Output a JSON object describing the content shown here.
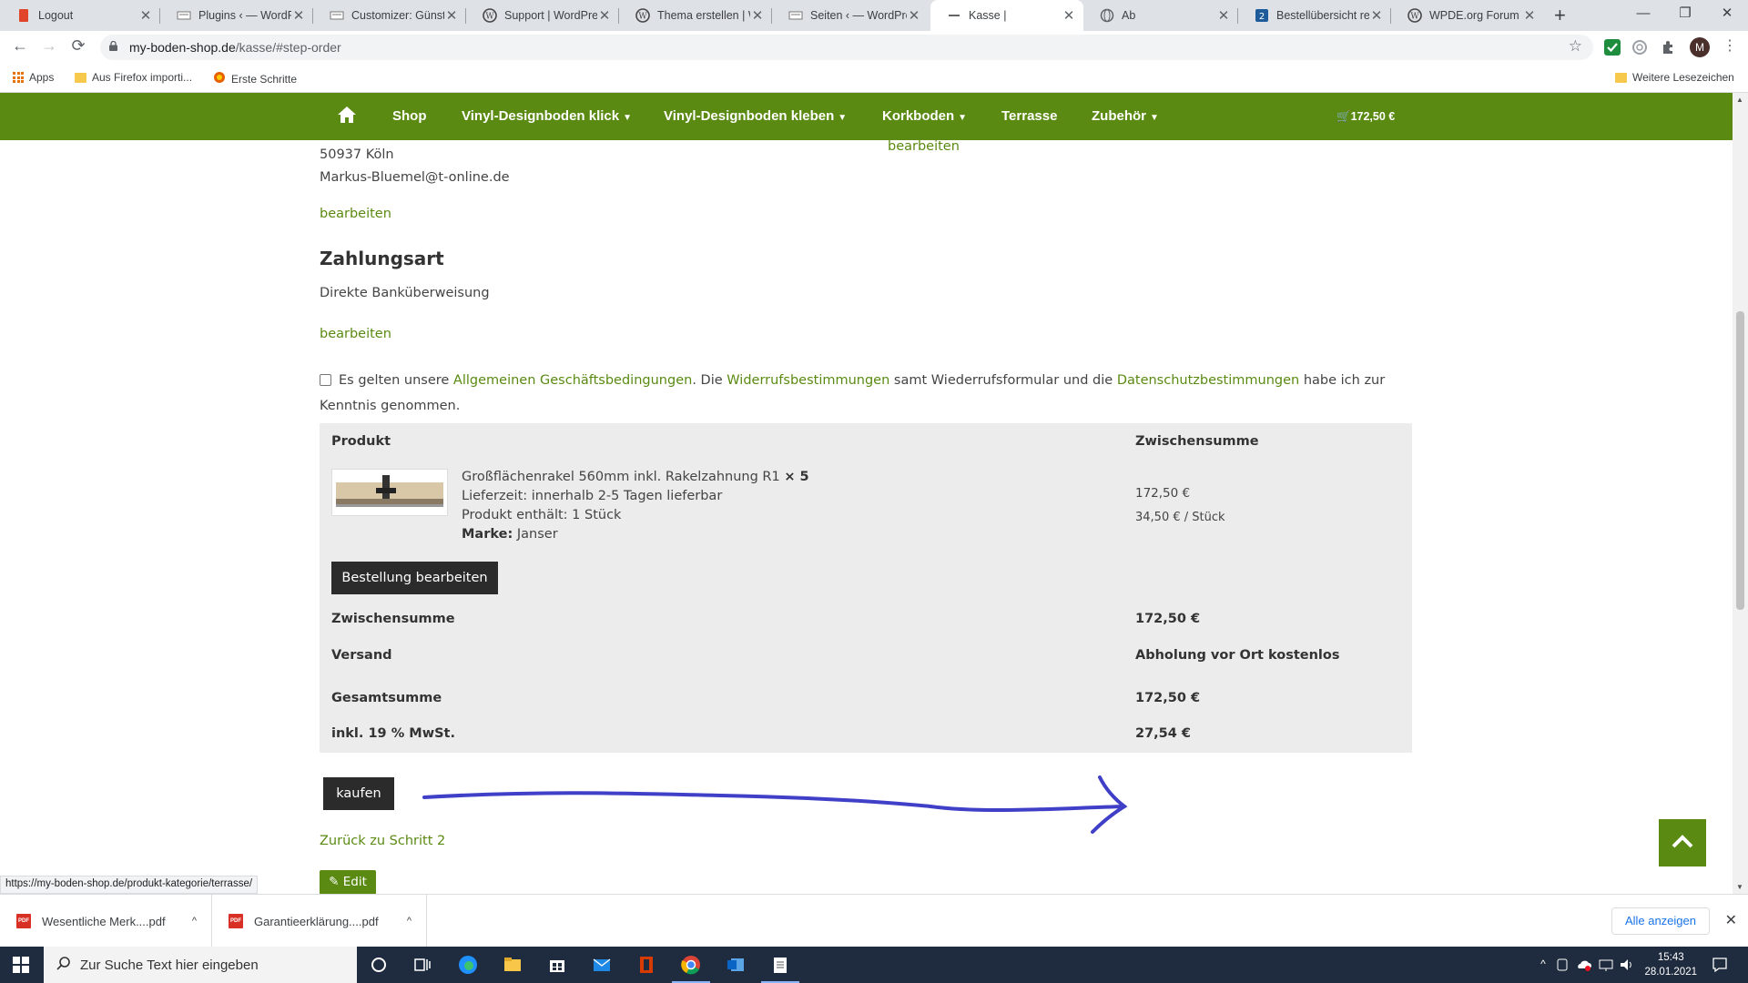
{
  "browser": {
    "tabs": [
      {
        "title": "Logout",
        "favicon": "red-document-icon"
      },
      {
        "title": "Plugins ‹ — WordPr",
        "favicon": "page-icon"
      },
      {
        "title": "Customizer: Günstig",
        "favicon": "page-icon"
      },
      {
        "title": "Support | WordPres",
        "favicon": "wordpress-icon"
      },
      {
        "title": "Thema erstellen | W",
        "favicon": "wordpress-icon"
      },
      {
        "title": "Seiten ‹ — WordPre",
        "favicon": "page-icon"
      },
      {
        "title": "Kasse |",
        "favicon": "dash-icon",
        "active": true
      },
      {
        "title": "Ab",
        "favicon": "globe-icon"
      },
      {
        "title": "Bestellübersicht rec",
        "favicon": "blue-square-icon"
      },
      {
        "title": "WPDE.org Forum",
        "favicon": "wordpress-icon"
      }
    ],
    "url_host": "my-boden-shop.de",
    "url_path": "/kasse/#step-order",
    "bookmarks": [
      "Apps",
      "Aus Firefox importi...",
      "Erste Schritte"
    ],
    "other_bookmarks": "Weitere Lesezeichen",
    "profile_initial": "M",
    "status_url": "https://my-boden-shop.de/produkt-kategorie/terrasse/"
  },
  "site_nav": {
    "items": [
      "Shop",
      "Vinyl-Designboden klick",
      "Vinyl-Designboden kleben",
      "Korkboden",
      "Terrasse",
      "Zubehör"
    ],
    "cart_total": "172,50 €"
  },
  "address": {
    "city": "50937 Köln",
    "email": "Markus-Bluemel@t-online.de",
    "edit": "bearbeiten",
    "edit_right": "bearbeiten"
  },
  "payment": {
    "heading": "Zahlungsart",
    "method": "Direkte Banküberweisung",
    "edit": "bearbeiten"
  },
  "terms": {
    "t1": "Es gelten unsere",
    "agb": "Allgemeinen Geschäftsbedingungen",
    "t2": ". Die",
    "widerruf": "Widerrufsbestimmungen",
    "t3": "samt Wiederrufsformular und die",
    "datenschutz": "Datenschutzbestimmungen",
    "t4": "habe ich zur Kenntnis genommen."
  },
  "order": {
    "col_product": "Produkt",
    "col_subtotal": "Zwischensumme",
    "product_name": "Großflächenrakel 560mm inkl. Rakelzahnung R1",
    "product_qty": "× 5",
    "delivery": "Lieferzeit: innerhalb 2-5 Tagen lieferbar",
    "contents": "Produkt enthält: 1 Stück",
    "brand_label": "Marke:",
    "brand": "Janser",
    "line_total": "172,50 €",
    "unit_price": "34,50 € / Stück",
    "edit_order": "Bestellung bearbeiten",
    "rows": [
      {
        "label": "Zwischensumme",
        "value": "172,50 €"
      },
      {
        "label": "Versand",
        "value": "Abholung vor Ort kostenlos"
      },
      {
        "label": "Gesamtsumme",
        "value": "172,50 €"
      },
      {
        "label": "inkl. 19 % MwSt.",
        "value": "27,54 €"
      }
    ]
  },
  "actions": {
    "buy": "kaufen",
    "back": "Zurück zu Schritt 2",
    "edit": "Edit"
  },
  "downloads": {
    "files": [
      "Wesentliche Merk....pdf",
      "Garantieerklärung....pdf"
    ],
    "show_all": "Alle anzeigen"
  },
  "taskbar": {
    "search_placeholder": "Zur Suche Text hier eingeben",
    "time": "15:43",
    "date": "28.01.2021"
  },
  "colors": {
    "brand_green": "#5a8a12",
    "annotation_blue": "#3f3fc8"
  }
}
